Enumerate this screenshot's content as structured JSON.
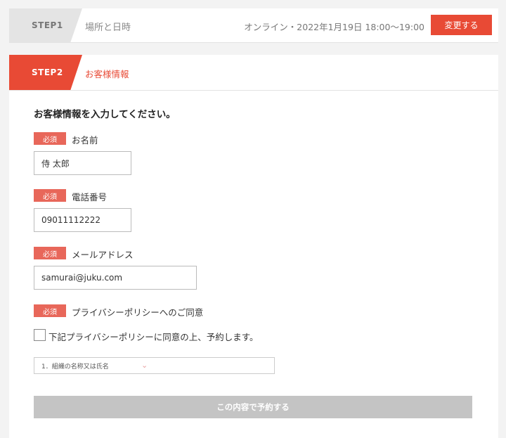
{
  "step1": {
    "tag": "STEP1",
    "label": "場所と日時",
    "info": "オンライン・2022年1月19日 18:00〜19:00",
    "change_button": "変更する"
  },
  "step2": {
    "tag": "STEP2",
    "label": "お客様情報"
  },
  "form": {
    "heading": "お客様情報を入力してください。",
    "required_badge": "必須",
    "name": {
      "label": "お名前",
      "value": "侍 太郎"
    },
    "phone": {
      "label": "電話番号",
      "value": "09011112222"
    },
    "email": {
      "label": "メールアドレス",
      "value": "samurai@juku.com"
    },
    "privacy": {
      "label": "プライバシーポリシーへのご同意",
      "checkbox_label": "下記プライバシーポリシーに同意の上、予約します。",
      "policy_text": "1．組織の名称又は氏名"
    },
    "submit": "この内容で予約する"
  },
  "colors": {
    "accent": "#e84a35",
    "badge": "#e8675a",
    "disabled": "#c4c4c4"
  }
}
